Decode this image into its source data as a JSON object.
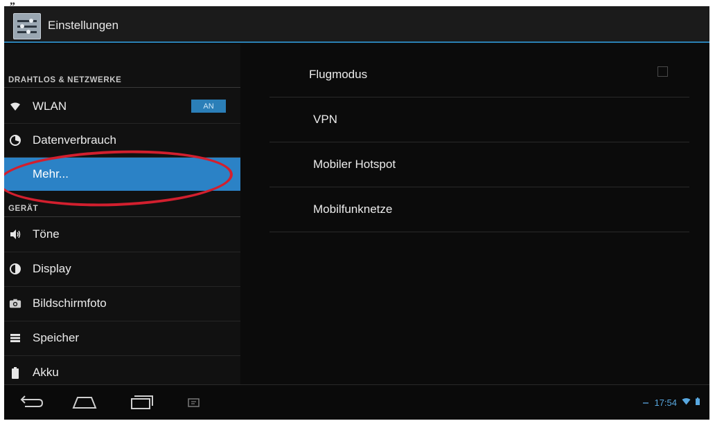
{
  "top_fragment": "„",
  "app": {
    "title": "Einstellungen",
    "icon": "settings-sliders-icon"
  },
  "sidebar": {
    "sections": [
      {
        "header": "DRAHTLOS & NETZWERKE",
        "items": [
          {
            "label": "WLAN",
            "icon": "wifi-icon",
            "toggle": "AN"
          },
          {
            "label": "Datenverbrauch",
            "icon": "data-usage-icon"
          },
          {
            "label": "Mehr...",
            "icon": "",
            "selected": true
          }
        ]
      },
      {
        "header": "GERÄT",
        "items": [
          {
            "label": "Töne",
            "icon": "speaker-icon"
          },
          {
            "label": "Display",
            "icon": "display-brightness-icon"
          },
          {
            "label": "Bildschirmfoto",
            "icon": "camera-icon"
          },
          {
            "label": "Speicher",
            "icon": "storage-icon"
          },
          {
            "label": "Akku",
            "icon": "battery-icon"
          }
        ]
      }
    ]
  },
  "detail": {
    "items": [
      {
        "label": "Flugmodus",
        "checked": false
      },
      {
        "label": "VPN"
      },
      {
        "label": "Mobiler Hotspot"
      },
      {
        "label": "Mobilfunknetze"
      }
    ]
  },
  "navbar": {
    "buttons": [
      "back-icon",
      "home-icon",
      "recent-apps-icon",
      "screenshot-icon"
    ]
  },
  "status_bar": {
    "time": "17:54",
    "icons": [
      "notification-icon",
      "wifi-status-icon",
      "battery-status-icon"
    ]
  },
  "annotation": {
    "color": "#d21f2e",
    "target": "Mehr..."
  },
  "colors": {
    "accent": "#2b82c6",
    "toggle_on": "#2b7fb8",
    "clock": "#58a8e0",
    "annotation_red": "#d21f2e",
    "background": "#0b0b0b"
  }
}
